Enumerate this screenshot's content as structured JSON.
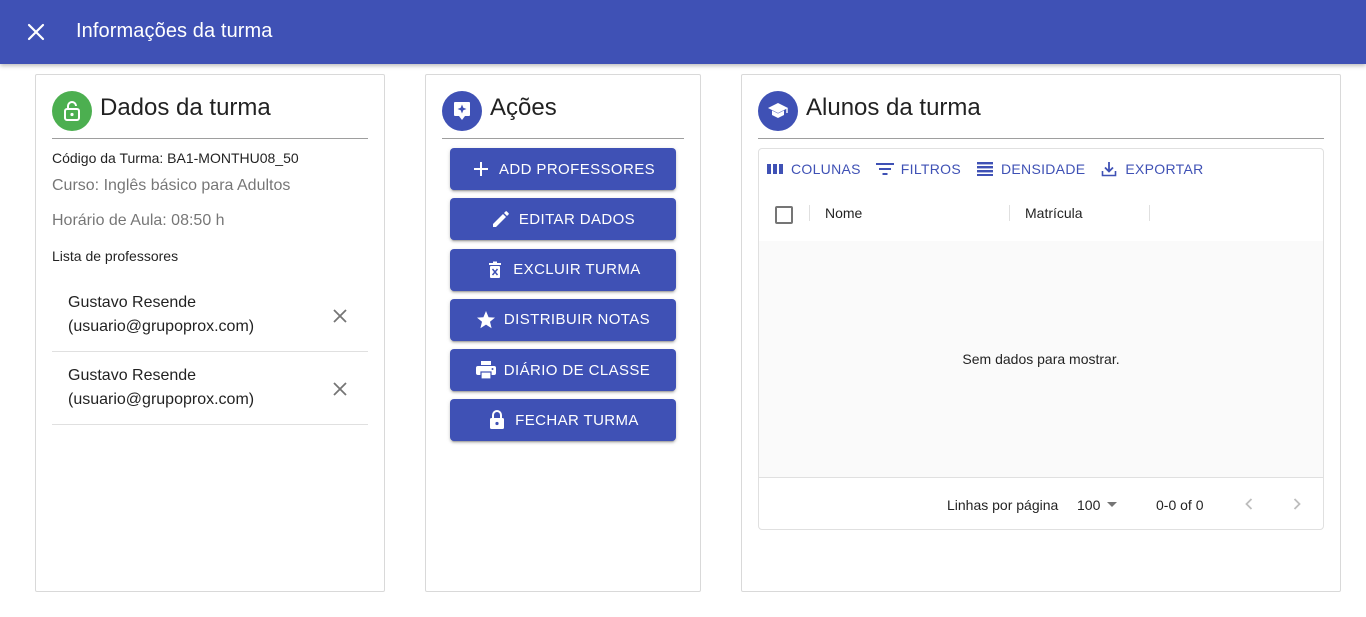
{
  "appbar": {
    "title": "Informações da turma",
    "bg_color": "#3f51b5",
    "close_icon": "close-icon"
  },
  "dados": {
    "title": "Dados da turma",
    "avatar_color": "#4caf50",
    "avatar_icon": "lock-open-icon",
    "codigo": "Código da Turma: BA1-MONTHU08_50",
    "curso": "Curso: Inglês básico para Adultos",
    "horario": "Horário de Aula: 08:50 h",
    "lista_label": "Lista de professores",
    "professores": [
      {
        "name": "Gustavo Resende",
        "email": "(usuario@grupoprox.com)"
      },
      {
        "name": "Gustavo Resende",
        "email": "(usuario@grupoprox.com)"
      }
    ]
  },
  "acoes": {
    "title": "Ações",
    "avatar_color": "#3f51b5",
    "avatar_icon": "new-badge-icon",
    "buttons": [
      {
        "label": "ADD PROFESSORES",
        "icon": "plus-icon"
      },
      {
        "label": "EDITAR DADOS",
        "icon": "pencil-icon"
      },
      {
        "label": "EXCLUIR TURMA",
        "icon": "delete-icon"
      },
      {
        "label": "DISTRIBUIR NOTAS",
        "icon": "star-icon"
      },
      {
        "label": "DIÁRIO DE CLASSE",
        "icon": "printer-icon"
      },
      {
        "label": "FECHAR TURMA",
        "icon": "lock-icon"
      }
    ]
  },
  "alunos": {
    "title": "Alunos da turma",
    "avatar_color": "#3f51b5",
    "avatar_icon": "school-icon",
    "toolbar": {
      "colunas": "COLUNAS",
      "filtros": "FILTROS",
      "densidade": "DENSIDADE",
      "exportar": "EXPORTAR"
    },
    "columns": [
      "Nome",
      "Matrícula"
    ],
    "empty_message": "Sem dados para mostrar.",
    "footer": {
      "rows_per_page_label": "Linhas por página",
      "rows_per_page_value": "100",
      "range": "0-0 of 0"
    }
  }
}
